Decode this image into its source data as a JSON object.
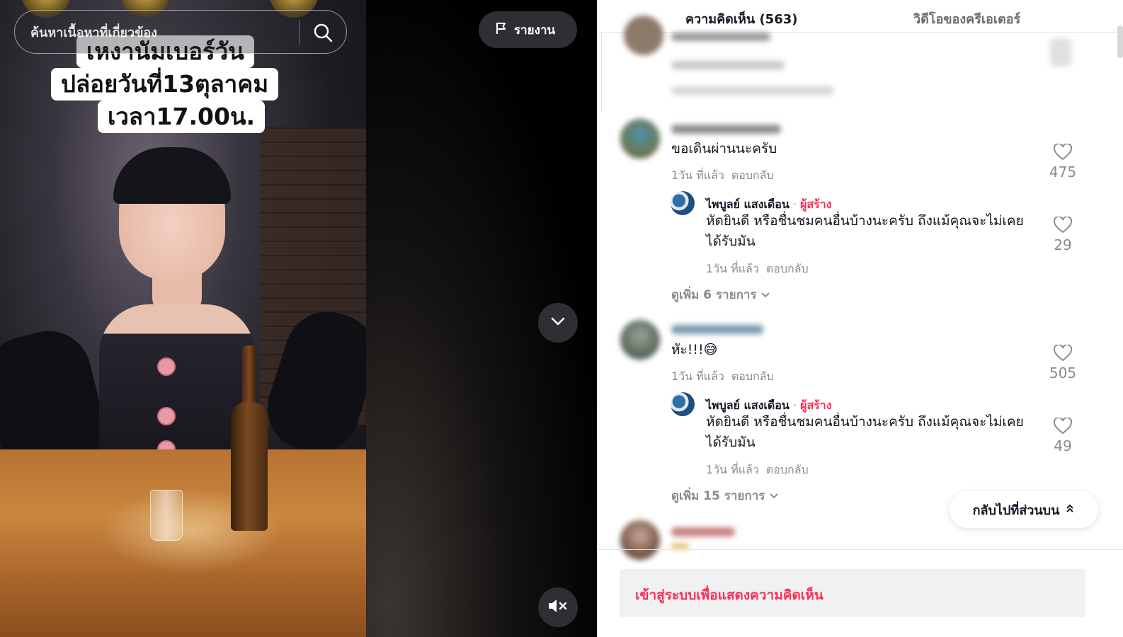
{
  "video": {
    "caption_lines": [
      "เหงานัมเบอร์วัน",
      "ปล่อยวันที่13ตุลาคม",
      "เวลา17.00น."
    ],
    "search_placeholder": "ค้นหาเนื้อหาที่เกี่ยวข้อง",
    "report_label": "รายงาน"
  },
  "panel": {
    "tabs": [
      {
        "label": "ความคิดเห็น (563)",
        "active": true
      },
      {
        "label": "วิดีโอของครีเอเตอร์",
        "active": false
      }
    ],
    "comments": [
      {
        "text": "ขอเดินผ่านนะครับ",
        "time": "1วัน ที่แล้ว",
        "reply_label": "ตอบกลับ",
        "likes": "475",
        "reply": {
          "username": "ไพบูลย์ แสงเดือน",
          "separator": " · ",
          "badge": "ผู้สร้าง",
          "text": "หัดยินดี หรือชื่นชมคนอื่นบ้างนะครับ ถึงแม้คุณจะไม่เคยได้รับมัน",
          "time": "1วัน ที่แล้ว",
          "reply_label": "ตอบกลับ",
          "likes": "29"
        },
        "view_more": "ดูเพิ่ม 6 รายการ"
      },
      {
        "text": "หัะ!!!😅",
        "time": "1วัน ที่แล้ว",
        "reply_label": "ตอบกลับ",
        "likes": "505",
        "reply": {
          "username": "ไพบูลย์ แสงเดือน",
          "separator": " · ",
          "badge": "ผู้สร้าง",
          "text": "หัดยินดี หรือชื่นชมคนอื่นบ้างนะครับ ถึงแม้คุณจะไม่เคยได้รับมัน",
          "time": "1วัน ที่แล้ว",
          "reply_label": "ตอบกลับ",
          "likes": "49"
        },
        "view_more": "ดูเพิ่ม 15 รายการ"
      }
    ],
    "back_to_top": "กลับไปที่ส่วนบน",
    "login_prompt": "เข้าสู่ระบบเพื่อแสดงความคิดเห็น"
  },
  "colors": {
    "accent": "#fe2c55",
    "text_primary": "#161823",
    "text_secondary": "#8a8b91",
    "dark_button": "#2f2f33"
  },
  "icons": [
    "search-icon",
    "flag-icon",
    "chevron-down-icon",
    "mute-icon",
    "heart-icon",
    "double-chevron-up-icon"
  ]
}
